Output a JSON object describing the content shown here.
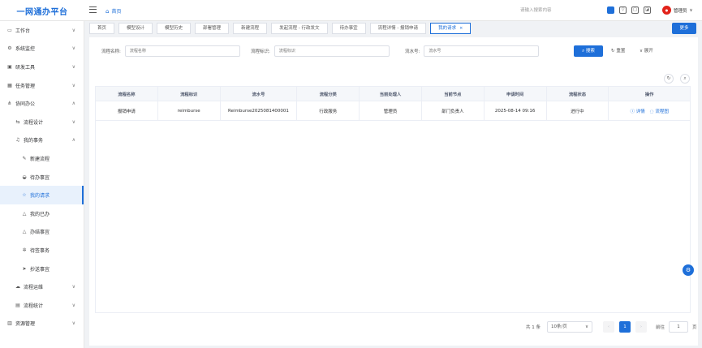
{
  "header": {
    "brand": "一网通办平台",
    "home": "首页",
    "search_placeholder": "请输入搜索内容",
    "user": "管理员"
  },
  "sidebar": {
    "items": [
      {
        "label": "工作台",
        "icon": "monitor-icon",
        "level": 0,
        "chevron": "∨"
      },
      {
        "label": "系统监控",
        "icon": "gear-icon",
        "level": 0,
        "chevron": "∨"
      },
      {
        "label": "研发工具",
        "icon": "toolbox-icon",
        "level": 0,
        "chevron": "∨"
      },
      {
        "label": "任务管理",
        "icon": "calendar-icon",
        "level": 0,
        "chevron": "∨"
      },
      {
        "label": "协同办公",
        "icon": "share-icon",
        "level": 0,
        "chevron": "∧"
      },
      {
        "label": "流程设计",
        "icon": "flow-icon",
        "level": 1,
        "chevron": "∨"
      },
      {
        "label": "我的事务",
        "icon": "bell-icon",
        "level": 1,
        "chevron": "∧"
      },
      {
        "label": "新建流程",
        "icon": "pen-icon",
        "level": 2,
        "chevron": ""
      },
      {
        "label": "待办事宜",
        "icon": "inbox-icon",
        "level": 2,
        "chevron": ""
      },
      {
        "label": "我的请求",
        "icon": "star-icon",
        "level": 2,
        "chevron": "",
        "active": true
      },
      {
        "label": "我的已办",
        "icon": "warning-icon",
        "level": 2,
        "chevron": ""
      },
      {
        "label": "办结事宜",
        "icon": "triangle-icon",
        "level": 2,
        "chevron": ""
      },
      {
        "label": "待签事务",
        "icon": "sun-icon",
        "level": 2,
        "chevron": ""
      },
      {
        "label": "抄送事宜",
        "icon": "send-icon",
        "level": 2,
        "chevron": ""
      },
      {
        "label": "流程运维",
        "icon": "cloud-icon",
        "level": 1,
        "chevron": "∨"
      },
      {
        "label": "流程统计",
        "icon": "chart-icon",
        "level": 1,
        "chevron": "∨"
      },
      {
        "label": "资源管理",
        "icon": "database-icon",
        "level": 0,
        "chevron": "∨"
      }
    ]
  },
  "tabs": [
    "首页",
    "模型设计",
    "模型历史",
    "部署管理",
    "新建流程",
    "发起流程 - 行政发文",
    "待办事宜",
    "流程详情 - 报销申请",
    "我的请求"
  ],
  "tab_close": "×",
  "more_button": "更多",
  "search": {
    "fields": [
      {
        "label": "流程名称:",
        "placeholder": "流程名称"
      },
      {
        "label": "流程标识:",
        "placeholder": "流程标识"
      },
      {
        "label": "流水号:",
        "placeholder": "流水号"
      }
    ],
    "search_button": "搜索",
    "reset_button": "重置",
    "expand_button": "展开"
  },
  "table": {
    "columns": [
      "流程名称",
      "流程标识",
      "流水号",
      "流程分类",
      "当前处理人",
      "当前节点",
      "申请时间",
      "流程状态",
      "操作"
    ],
    "rows": [
      [
        "报销申请",
        "reimburse",
        "Reimburse2025081400001",
        "行政服务",
        "管理员",
        "部门负责人",
        "2025-08-14 09:16",
        "进行中"
      ]
    ],
    "actions": [
      "详情",
      "流程图"
    ]
  },
  "pagination": {
    "total": "共 1 条",
    "page_size": "10条/页",
    "current": "1",
    "goto_label": "前往",
    "goto_value": "1",
    "page_suffix": "页"
  }
}
